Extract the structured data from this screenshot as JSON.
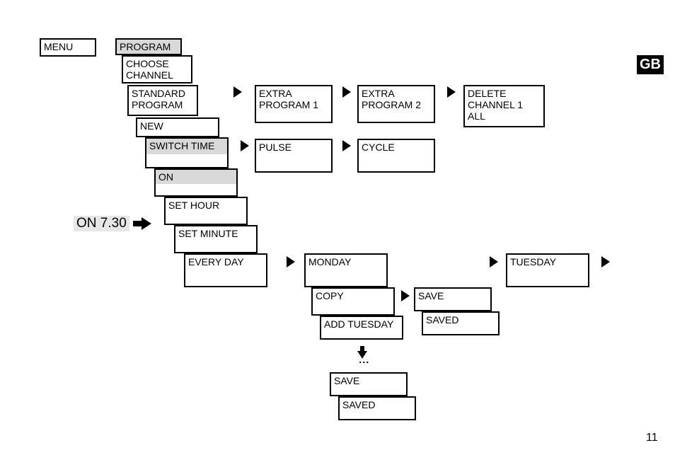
{
  "language_badge": "GB",
  "page_number": "11",
  "on_label": "ON 7.30",
  "boxes": {
    "menu": "MENU",
    "program": "PROGRAM",
    "choose_channel": "CHOOSE CHANNEL",
    "standard_program": "STANDARD PROGRAM",
    "extra_program_1": "EXTRA PROGRAM 1",
    "extra_program_2": "EXTRA PROGRAM 2",
    "delete_channel": "DELETE CHANNEL 1 ALL",
    "new": "NEW",
    "switch_time": "SWITCH TIME",
    "pulse": "PULSE",
    "cycle": "CYCLE",
    "on": "ON",
    "set_hour": "SET HOUR",
    "set_minute": "SET MINUTE",
    "every_day": "EVERY DAY",
    "monday": "MONDAY",
    "tuesday": "TUESDAY",
    "copy": "COPY",
    "save": "SAVE",
    "add_tuesday": "ADD TUESDAY",
    "saved": "SAVED",
    "save2": "SAVE",
    "saved2": "SAVED"
  },
  "dots": "⋮"
}
